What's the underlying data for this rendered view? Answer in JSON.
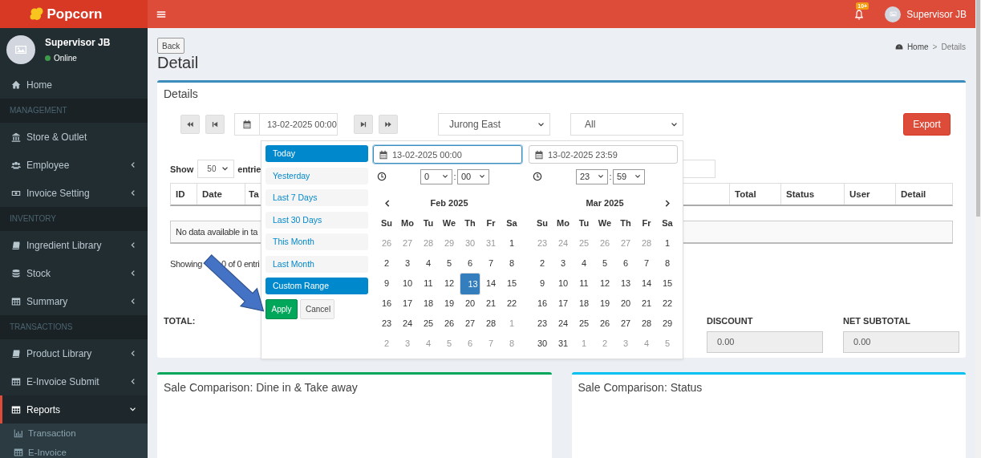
{
  "brand": {
    "name": "Popcorn"
  },
  "topbar": {
    "notification_badge": "10+",
    "user_name": "Supervisor JB"
  },
  "user_panel": {
    "name": "Supervisor JB",
    "status": "Online"
  },
  "sidebar": {
    "items": [
      {
        "kind": "item",
        "label": "Home",
        "selected": false
      },
      {
        "kind": "header",
        "label": "MANAGEMENT"
      },
      {
        "kind": "item",
        "label": "Store & Outlet",
        "selected": false
      },
      {
        "kind": "item",
        "label": "Employee",
        "selected": false,
        "expanded": false
      },
      {
        "kind": "item",
        "label": "Invoice Setting",
        "selected": false,
        "expanded": false
      },
      {
        "kind": "header",
        "label": "INVENTORY"
      },
      {
        "kind": "item",
        "label": "Ingredient Library",
        "selected": false,
        "expanded": false
      },
      {
        "kind": "item",
        "label": "Stock",
        "selected": false,
        "expanded": false
      },
      {
        "kind": "item",
        "label": "Summary",
        "selected": false,
        "expanded": false
      },
      {
        "kind": "header",
        "label": "TRANSACTIONS"
      },
      {
        "kind": "item",
        "label": "Product Library",
        "selected": false,
        "expanded": false
      },
      {
        "kind": "item",
        "label": "E-Invoice Submit",
        "selected": false,
        "expanded": false
      },
      {
        "kind": "item",
        "label": "Reports",
        "selected": true,
        "expanded": true,
        "children": [
          {
            "label": "Transaction",
            "selected": false
          },
          {
            "label": "E-Invoice",
            "selected": false
          }
        ]
      }
    ]
  },
  "page": {
    "back_button": "Back",
    "title": "Detail",
    "breadcrumb": {
      "items": [
        "Home",
        "Details"
      ],
      "separator": ">"
    }
  },
  "details": {
    "title": "Details",
    "date_value": "13-02-2025 00:00",
    "outlet_select": "Jurong East",
    "status_select": "All",
    "export_button": "Export",
    "show_label": "Show",
    "page_size": "50",
    "entries_label": "entrie",
    "columns": [
      {
        "label": "ID"
      },
      {
        "label": "Date"
      },
      {
        "label": "Ta"
      },
      {
        "label": "Total"
      },
      {
        "label": "Status"
      },
      {
        "label": "User"
      },
      {
        "label": "Detail"
      }
    ],
    "empty_message": "No data available in ta",
    "info_start": "Showing",
    "info_end": "0 of 0 entri",
    "total_label": "TOTAL:",
    "totals": [
      {
        "label": "DISCOUNT",
        "value": "0.00"
      },
      {
        "label": "NET SUBTOTAL",
        "value": "0.00"
      }
    ]
  },
  "date_picker": {
    "ranges": [
      {
        "label": "Today",
        "selected": true
      },
      {
        "label": "Yesterday",
        "selected": false
      },
      {
        "label": "Last 7 Days",
        "selected": false
      },
      {
        "label": "Last 30 Days",
        "selected": false
      },
      {
        "label": "This Month",
        "selected": false
      },
      {
        "label": "Last Month",
        "selected": false
      },
      {
        "label": "Custom Range",
        "selected": true
      }
    ],
    "apply_button": "Apply",
    "cancel_button": "Cancel",
    "calendars": [
      {
        "input": "13-02-2025 00:00",
        "active": true,
        "hour": "0",
        "separator": ":",
        "minute": "00",
        "month": "Feb 2025",
        "kind": "first",
        "weekdays": [
          "Su",
          "Mo",
          "Tu",
          "We",
          "Th",
          "Fr",
          "Sa"
        ],
        "weeks": [
          [
            {
              "d": "26",
              "off": true,
              "selected": false
            },
            {
              "d": "27",
              "off": true,
              "selected": false
            },
            {
              "d": "28",
              "off": true,
              "selected": false
            },
            {
              "d": "29",
              "off": true,
              "selected": false
            },
            {
              "d": "30",
              "off": true,
              "selected": false
            },
            {
              "d": "31",
              "off": true,
              "selected": false
            },
            {
              "d": "1",
              "off": false,
              "selected": false
            }
          ],
          [
            {
              "d": "2",
              "off": false,
              "selected": false
            },
            {
              "d": "3",
              "off": false,
              "selected": false
            },
            {
              "d": "4",
              "off": false,
              "selected": false
            },
            {
              "d": "5",
              "off": false,
              "selected": false
            },
            {
              "d": "6",
              "off": false,
              "selected": false
            },
            {
              "d": "7",
              "off": false,
              "selected": false
            },
            {
              "d": "8",
              "off": false,
              "selected": false
            }
          ],
          [
            {
              "d": "9",
              "off": false,
              "selected": false
            },
            {
              "d": "10",
              "off": false,
              "selected": false
            },
            {
              "d": "11",
              "off": false,
              "selected": false
            },
            {
              "d": "12",
              "off": false,
              "selected": false
            },
            {
              "d": "13",
              "off": false,
              "selected": true
            },
            {
              "d": "14",
              "off": false,
              "selected": false
            },
            {
              "d": "15",
              "off": false,
              "selected": false
            }
          ],
          [
            {
              "d": "16",
              "off": false,
              "selected": false
            },
            {
              "d": "17",
              "off": false,
              "selected": false
            },
            {
              "d": "18",
              "off": false,
              "selected": false
            },
            {
              "d": "19",
              "off": false,
              "selected": false
            },
            {
              "d": "20",
              "off": false,
              "selected": false
            },
            {
              "d": "21",
              "off": false,
              "selected": false
            },
            {
              "d": "22",
              "off": false,
              "selected": false
            }
          ],
          [
            {
              "d": "23",
              "off": false,
              "selected": false
            },
            {
              "d": "24",
              "off": false,
              "selected": false
            },
            {
              "d": "25",
              "off": false,
              "selected": false
            },
            {
              "d": "26",
              "off": false,
              "selected": false
            },
            {
              "d": "27",
              "off": false,
              "selected": false
            },
            {
              "d": "28",
              "off": false,
              "selected": false
            },
            {
              "d": "1",
              "off": true,
              "selected": false
            }
          ],
          [
            {
              "d": "2",
              "off": true,
              "selected": false
            },
            {
              "d": "3",
              "off": true,
              "selected": false
            },
            {
              "d": "4",
              "off": true,
              "selected": false
            },
            {
              "d": "5",
              "off": true,
              "selected": false
            },
            {
              "d": "6",
              "off": true,
              "selected": false
            },
            {
              "d": "7",
              "off": true,
              "selected": false
            },
            {
              "d": "8",
              "off": true,
              "selected": false
            }
          ]
        ]
      },
      {
        "input": "13-02-2025 23:59",
        "active": false,
        "hour": "23",
        "separator": ":",
        "minute": "59",
        "month": "Mar 2025",
        "kind": "last",
        "weekdays": [
          "Su",
          "Mo",
          "Tu",
          "We",
          "Th",
          "Fr",
          "Sa"
        ],
        "weeks": [
          [
            {
              "d": "23",
              "off": true,
              "selected": false
            },
            {
              "d": "24",
              "off": true,
              "selected": false
            },
            {
              "d": "25",
              "off": true,
              "selected": false
            },
            {
              "d": "26",
              "off": true,
              "selected": false
            },
            {
              "d": "27",
              "off": true,
              "selected": false
            },
            {
              "d": "28",
              "off": true,
              "selected": false
            },
            {
              "d": "1",
              "off": false,
              "selected": false
            }
          ],
          [
            {
              "d": "2",
              "off": false,
              "selected": false
            },
            {
              "d": "3",
              "off": false,
              "selected": false
            },
            {
              "d": "4",
              "off": false,
              "selected": false
            },
            {
              "d": "5",
              "off": false,
              "selected": false
            },
            {
              "d": "6",
              "off": false,
              "selected": false
            },
            {
              "d": "7",
              "off": false,
              "selected": false
            },
            {
              "d": "8",
              "off": false,
              "selected": false
            }
          ],
          [
            {
              "d": "9",
              "off": false,
              "selected": false
            },
            {
              "d": "10",
              "off": false,
              "selected": false
            },
            {
              "d": "11",
              "off": false,
              "selected": false
            },
            {
              "d": "12",
              "off": false,
              "selected": false
            },
            {
              "d": "13",
              "off": false,
              "selected": false
            },
            {
              "d": "14",
              "off": false,
              "selected": false
            },
            {
              "d": "15",
              "off": false,
              "selected": false
            }
          ],
          [
            {
              "d": "16",
              "off": false,
              "selected": false
            },
            {
              "d": "17",
              "off": false,
              "selected": false
            },
            {
              "d": "18",
              "off": false,
              "selected": false
            },
            {
              "d": "19",
              "off": false,
              "selected": false
            },
            {
              "d": "20",
              "off": false,
              "selected": false
            },
            {
              "d": "21",
              "off": false,
              "selected": false
            },
            {
              "d": "22",
              "off": false,
              "selected": false
            }
          ],
          [
            {
              "d": "23",
              "off": false,
              "selected": false
            },
            {
              "d": "24",
              "off": false,
              "selected": false
            },
            {
              "d": "25",
              "off": false,
              "selected": false
            },
            {
              "d": "26",
              "off": false,
              "selected": false
            },
            {
              "d": "27",
              "off": false,
              "selected": false
            },
            {
              "d": "28",
              "off": false,
              "selected": false
            },
            {
              "d": "29",
              "off": false,
              "selected": false
            }
          ],
          [
            {
              "d": "30",
              "off": false,
              "selected": false
            },
            {
              "d": "31",
              "off": false,
              "selected": false
            },
            {
              "d": "1",
              "off": true,
              "selected": false
            },
            {
              "d": "2",
              "off": true,
              "selected": false
            },
            {
              "d": "3",
              "off": true,
              "selected": false
            },
            {
              "d": "4",
              "off": true,
              "selected": false
            },
            {
              "d": "5",
              "off": true,
              "selected": false
            }
          ]
        ]
      }
    ]
  },
  "panels": [
    {
      "title": "Sale Comparison: Dine in & Take away",
      "color": "#00a65a"
    },
    {
      "title": "Sale Comparison: Status",
      "color": "#00c0ef"
    }
  ]
}
